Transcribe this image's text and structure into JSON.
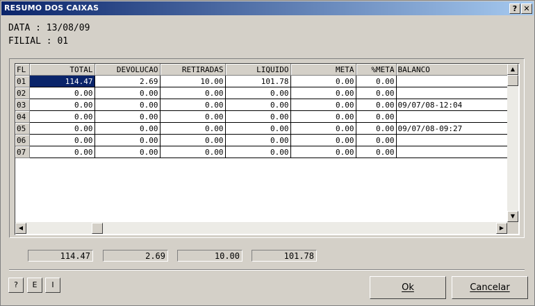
{
  "window": {
    "title": "RESUMO DOS CAIXAS",
    "help_btn": "?",
    "close_btn": "✕"
  },
  "info": {
    "data_line": "DATA   : 13/08/09",
    "filial_line": "FILIAL : 01"
  },
  "grid": {
    "headers": [
      "FL",
      "TOTAL",
      "DEVOLUCAO",
      "RETIRADAS",
      "LIQUIDO",
      "META",
      "%META",
      "BALANCO"
    ],
    "rows": [
      [
        "01",
        "114.47",
        "2.69",
        "10.00",
        "101.78",
        "0.00",
        "0.00",
        ""
      ],
      [
        "02",
        "0.00",
        "0.00",
        "0.00",
        "0.00",
        "0.00",
        "0.00",
        ""
      ],
      [
        "03",
        "0.00",
        "0.00",
        "0.00",
        "0.00",
        "0.00",
        "0.00",
        "09/07/08-12:04"
      ],
      [
        "04",
        "0.00",
        "0.00",
        "0.00",
        "0.00",
        "0.00",
        "0.00",
        ""
      ],
      [
        "05",
        "0.00",
        "0.00",
        "0.00",
        "0.00",
        "0.00",
        "0.00",
        "09/07/08-09:27"
      ],
      [
        "06",
        "0.00",
        "0.00",
        "0.00",
        "0.00",
        "0.00",
        "0.00",
        ""
      ],
      [
        "07",
        "0.00",
        "0.00",
        "0.00",
        "0.00",
        "0.00",
        "0.00",
        ""
      ]
    ]
  },
  "totals": [
    "114.47",
    "2.69",
    "10.00",
    "101.78"
  ],
  "buttons": {
    "help": "?",
    "e": "E",
    "i": "I",
    "ok": "Ok",
    "cancel": "Cancelar"
  }
}
